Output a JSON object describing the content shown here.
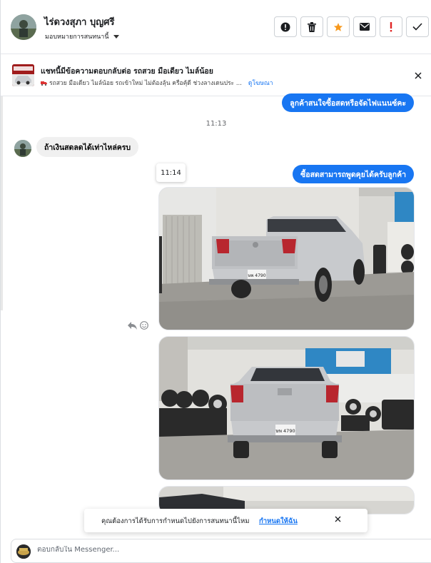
{
  "header": {
    "contact_name": "ไร่ดวงสุภา บุญศรี",
    "assign_label": "มอบหมายการสนทนานี้",
    "actions": [
      {
        "name": "report-button",
        "icon": "exclamation-circle-icon"
      },
      {
        "name": "delete-button",
        "icon": "trash-icon"
      },
      {
        "name": "star-button",
        "icon": "star-icon"
      },
      {
        "name": "mark-unread-button",
        "icon": "envelope-icon"
      },
      {
        "name": "spam-button",
        "icon": "exclamation-icon"
      },
      {
        "name": "done-button",
        "icon": "check-icon"
      }
    ],
    "star_color": "#f7981c",
    "spam_color": "#e02424"
  },
  "banner": {
    "title": "แชทนี้มีข้อความตอบกลับต่อ รถสวย มือเดียว ไมล์น้อย",
    "subtitle": "รถสวย มือเดียว ไมล์น้อย รถเข้าใหม่ ไม่ต้องลุ้น ครือคุ้ดี ช่วงลางเดนประ ...",
    "link": "ดูโฆษณา"
  },
  "messages": {
    "out_1": "ลูกค้าสนใจซื้อสดหรือจัดไฟแนนซ์คะ",
    "time_1": "11:13",
    "in_1": "ถ้าเงินสดลดได้เท่าไหล่ครบ",
    "time_2": "11:14",
    "out_2": "ซื้อสดสามารถพูดคุยได้ครับลูกค้า",
    "plate_1": "ษพ 4790",
    "plate_2": "ษพ 4790"
  },
  "notice": {
    "text": "คุณต้องการได้รับการกำหนดไปยังการสนทนานี้ไหม",
    "link": "กำหนดให้ฉัน"
  },
  "composer": {
    "placeholder": "ตอบกลับใน Messenger..."
  },
  "colors": {
    "accent": "#1876f2",
    "incoming_bubble": "#f0f0f0"
  }
}
